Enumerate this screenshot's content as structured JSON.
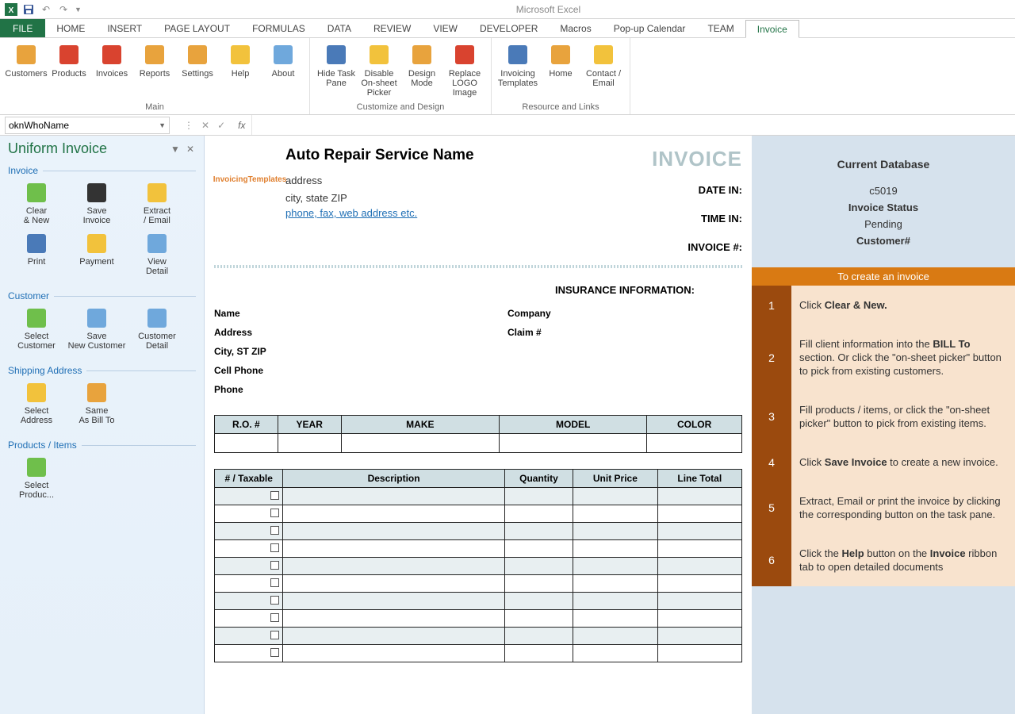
{
  "app_title": "Microsoft Excel",
  "ribbon_tabs": [
    "FILE",
    "HOME",
    "INSERT",
    "PAGE LAYOUT",
    "FORMULAS",
    "DATA",
    "REVIEW",
    "VIEW",
    "DEVELOPER",
    "Macros",
    "Pop-up Calendar",
    "TEAM",
    "Invoice"
  ],
  "active_tab": "Invoice",
  "ribbon_groups": [
    {
      "label": "Main",
      "buttons": [
        "Customers",
        "Products",
        "Invoices",
        "Reports",
        "Settings",
        "Help",
        "About"
      ]
    },
    {
      "label": "Customize and Design",
      "buttons": [
        "Hide Task Pane",
        "Disable On-sheet Picker",
        "Design Mode",
        "Replace LOGO Image"
      ]
    },
    {
      "label": "Resource and Links",
      "buttons": [
        "Invoicing Templates",
        "Home",
        "Contact / Email"
      ]
    }
  ],
  "namebox": "oknWhoName",
  "taskpane": {
    "title": "Uniform Invoice",
    "sections": [
      {
        "header": "Invoice",
        "items": [
          "Clear & New",
          "Save Invoice",
          "Extract / Email",
          "Print",
          "Payment",
          "View Detail"
        ]
      },
      {
        "header": "Customer",
        "items": [
          "Select Customer",
          "Save New Customer",
          "Customer Detail"
        ]
      },
      {
        "header": "Shipping Address",
        "items": [
          "Select Address",
          "Same As Bill To"
        ]
      },
      {
        "header": "Products / Items",
        "items": [
          "Select Produc..."
        ]
      }
    ]
  },
  "invoice": {
    "company_name": "Auto Repair Service Name",
    "address": "address",
    "city": "city, state ZIP",
    "contact": "phone, fax, web address etc.",
    "title": "INVOICE",
    "logo_text": "InvoicingTemplates",
    "meta_labels": {
      "date_in": "DATE IN:",
      "time_in": "TIME IN:",
      "invoice_no": "INVOICE #:"
    },
    "insurance_header": "INSURANCE INFORMATION:",
    "customer_labels": {
      "name": "Name",
      "address": "Address",
      "city": "City, ST ZIP",
      "cell": "Cell Phone",
      "phone": "Phone",
      "company": "Company",
      "claim": "Claim #"
    },
    "vehicle_cols": [
      "R.O. #",
      "YEAR",
      "MAKE",
      "MODEL",
      "COLOR"
    ],
    "item_cols": [
      "# / Taxable",
      "Description",
      "Quantity",
      "Unit Price",
      "Line Total"
    ]
  },
  "info_panel": {
    "db_title": "Current Database",
    "db_id": "c5019",
    "status_label": "Invoice Status",
    "status": "Pending",
    "customer_label": "Customer#",
    "create_header": "To create an invoice",
    "steps": [
      {
        "n": "1",
        "html": "Click <b>Clear & New.</b>"
      },
      {
        "n": "2",
        "html": "Fill client information into the <b>BILL To</b> section. Or click the \"on-sheet picker\" button to pick from existing customers."
      },
      {
        "n": "3",
        "html": "Fill products / items, or click the \"on-sheet picker\" button to pick from existing items."
      },
      {
        "n": "4",
        "html": "Click <b>Save Invoice</b> to create a new invoice."
      },
      {
        "n": "5",
        "html": "Extract, Email or print the invoice by clicking the corresponding button on the task pane."
      },
      {
        "n": "6",
        "html": "Click the <b>Help</b> button on the <b>Invoice</b> ribbon tab to open detailed documents"
      }
    ]
  }
}
